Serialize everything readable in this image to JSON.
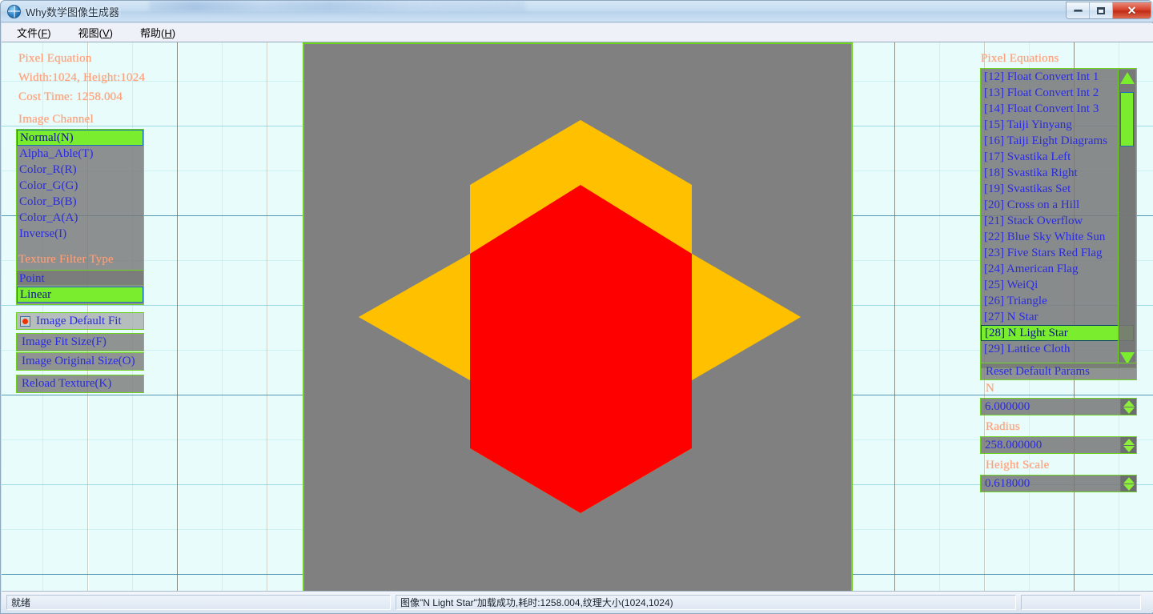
{
  "window": {
    "title": "Why数学图像生成器",
    "icon": "app-globe-icon",
    "buttons": {
      "minimize": "─",
      "maximize": "□",
      "close": "✕"
    }
  },
  "menu": {
    "items": [
      {
        "label": "文件(F)",
        "accel": "F",
        "text": "文件"
      },
      {
        "label": "视图(V)",
        "accel": "V",
        "text": "视图"
      },
      {
        "label": "帮助(H)",
        "accel": "H",
        "text": "帮助"
      }
    ]
  },
  "left_panel": {
    "heading": "Pixel Equation",
    "size_info": "Width:1024, Height:1024",
    "cost_time": "Cost Time: 1258.004",
    "image_channel_label": "Image Channel",
    "image_channel_items": [
      "Normal(N)",
      "Alpha_Able(T)",
      "Color_R(R)",
      "Color_G(G)",
      "Color_B(B)",
      "Color_A(A)",
      "Inverse(I)"
    ],
    "image_channel_selected": "Normal(N)",
    "texture_filter_label": "Texture Filter Type",
    "texture_filter_items": [
      "Point",
      "Linear"
    ],
    "texture_filter_selected": "Linear",
    "image_default_fit": "Image Default Fit",
    "image_default_fit_checked": true,
    "buttons": [
      "Image Fit Size(F)",
      "Image Original Size(O)",
      "Reload Texture(K)"
    ]
  },
  "right_panel": {
    "heading": "Pixel Equations",
    "equations": [
      "[12] Float Convert Int 1",
      "[13] Float Convert Int 2",
      "[14] Float Convert Int 3",
      "[15] Taiji Yinyang",
      "[16] Taiji Eight Diagrams",
      "[17] Svastika Left",
      "[18] Svastika Right",
      "[19] Svastikas Set",
      "[20] Cross on a Hill",
      "[21] Stack Overflow",
      "[22] Blue Sky White Sun",
      "[23] Five Stars Red Flag",
      "[24] American Flag",
      "[25] WeiQi",
      "[26] Triangle",
      "[27] N Star",
      "[28] N Light Star",
      "[29] Lattice Cloth"
    ],
    "selected_equation": "[28] N Light Star",
    "reset_button": "Reset Default Params",
    "params": [
      {
        "label": "N",
        "value": "6.000000"
      },
      {
        "label": "Radius",
        "value": "258.000000"
      },
      {
        "label": "Height Scale",
        "value": "0.618000"
      }
    ]
  },
  "canvas": {
    "background_color": "#808080",
    "star_point_color": "#FFC000",
    "star_center_color": "#FF0000",
    "points": 6
  },
  "statusbar": {
    "ready": "就绪",
    "message": "图像\"N Light Star\"加载成功,耗时:1258.004,纹理大小(1024,1024)",
    "right": ""
  }
}
